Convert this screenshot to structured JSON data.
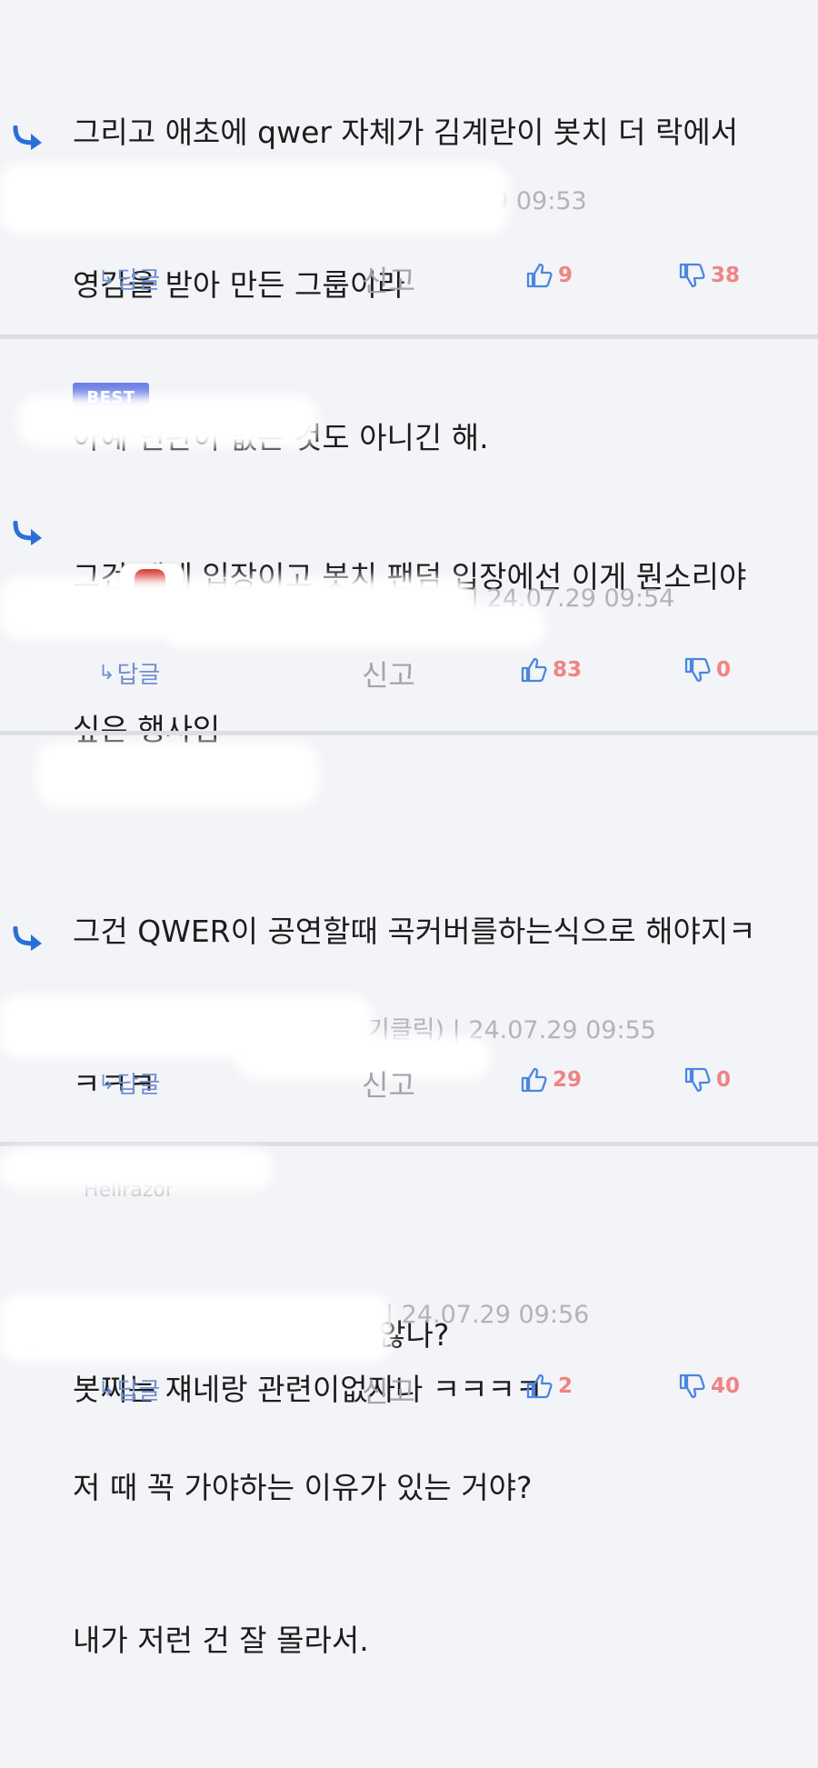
{
  "comments": [
    {
      "lines": [
        "그리고 애초에 qwer 자체가 김계란이 봇치 더 락에서",
        "영감을 받아 만든 그룹이라",
        "아예 연관이 없는 것도 아니긴 해."
      ],
      "meta": "07.29 09:53",
      "best": "",
      "author": "",
      "reply_label": "답글",
      "report_label": "신고",
      "likes": "9",
      "dislikes": "38"
    },
    {
      "lines": [
        "그건 게네 입장이고 봇치 팬덤 입장에선 이게 뭔소리야",
        "싶은 행사임"
      ],
      "meta": "| 24.07.29 09:54",
      "best": "BEST",
      "author": "",
      "reply_label": "답글",
      "report_label": "신고",
      "likes": "83",
      "dislikes": "0"
    },
    {
      "lines": [
        "그건 QWER이 공연할때 곡커버를하는식으로 해야지ㅋ",
        "ㅋㅋㅋ",
        "",
        "봇찌는 쟤네랑 관련이없자나 ㅋㅋㅋㅋ"
      ],
      "meta": "기클릭) | 24.07.29 09:55",
      "best": "",
      "author": "",
      "reply_label": "답글",
      "report_label": "신고",
      "likes": "29",
      "dislikes": "0"
    },
    {
      "lines": [
        "그럼 저 때 안 가면 되지 않나?",
        "저 때 꼭 가야하는 이유가 있는 거야?",
        "내가 저런 건 잘 몰라서."
      ],
      "meta": "| 24.07.29 09:56",
      "best": "",
      "author": "Hellrazor",
      "reply_label": "답글",
      "report_label": "신고",
      "likes": "2",
      "dislikes": "40"
    }
  ],
  "colors": {
    "background": "#f3f4f7",
    "divider": "#dcdee3",
    "reply_arrow": "#2a6fd8",
    "reply_link": "#6f8fd0",
    "vote_count": "#f08383",
    "vote_icon": "#4a86e0",
    "best_badge": "#6d7fe6"
  },
  "icons": [
    "reply-arrow-icon",
    "reply-small-arrow-icon",
    "thumbs-up-icon",
    "thumbs-down-icon"
  ]
}
